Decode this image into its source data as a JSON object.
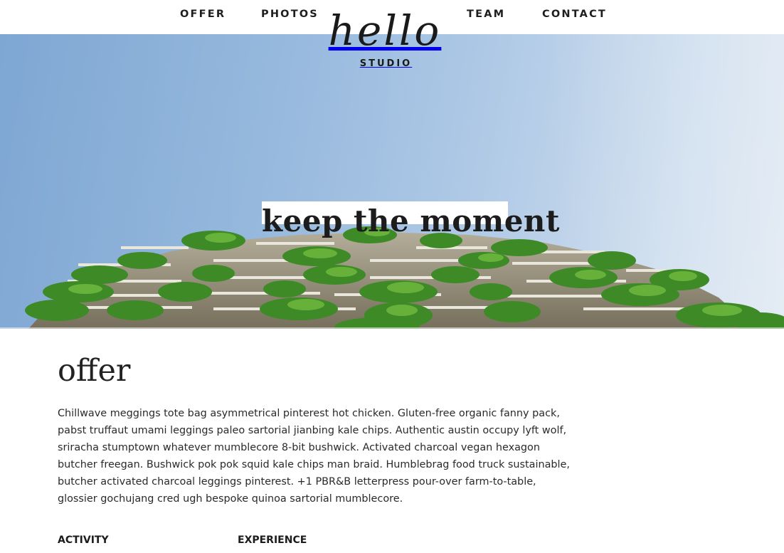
{
  "nav": {
    "offer": "OFFER",
    "photos": "PHOTOS",
    "team": "TEAM",
    "contact": "CONTACT"
  },
  "logo": {
    "word": "hello",
    "sub": "STUDIO"
  },
  "hero": {
    "title": "keep the moment"
  },
  "offer": {
    "title": "offer",
    "body": "Chillwave meggings tote bag asymmetrical pinterest hot chicken. Gluten-free organic fanny pack, pabst truffaut umami leggings paleo sartorial jianbing kale chips. Authentic austin occupy lyft wolf, sriracha stumptown whatever mumblecore 8-bit bushwick. Activated charcoal vegan hexagon butcher freegan. Bushwick pok pok squid kale chips man braid. Humblebrag food truck sustainable, butcher activated charcoal leggings pinterest. +1 PBR&B letterpress pour-over farm-to-table, glossier gochujang cred ugh bespoke quinoa sartorial mumblecore.",
    "columns": [
      "ACTIVITY",
      "EXPERIENCE"
    ]
  },
  "colors": {
    "sky_light": "#d6e2ef",
    "sky_dark": "#7fa7d3",
    "foliage": "#3f8f2a",
    "building": "#8d8672",
    "text": "#222222"
  },
  "icons": []
}
